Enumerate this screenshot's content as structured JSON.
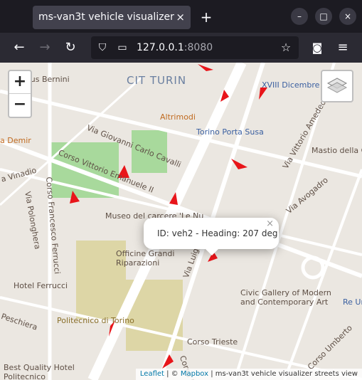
{
  "browser": {
    "tab_title": "ms-van3t vehicle visualizer",
    "tab_close": "×",
    "new_tab": "+",
    "url_host": "127.0.0.1",
    "url_port": ":8080",
    "icons": [
      "back-icon",
      "forward-icon",
      "reload-icon",
      "shield-icon",
      "page-icon",
      "star-icon",
      "pocket-icon",
      "menu-icon"
    ]
  },
  "map": {
    "zoom_in": "+",
    "zoom_out": "−",
    "popup_text": "ID: veh2 - Heading: 207 deg",
    "popup_close": "×",
    "attribution": {
      "leaflet": "Leaflet",
      "sep1": " | © ",
      "mapbox": "Mapbox",
      "tail": " | ms-van3t vehicle visualizer streets view"
    },
    "labels": [
      "mplus Bernini",
      "CIT TURIN",
      "XVIII Dicembre",
      "Altrimodi",
      "Via Giovanni Carlo Cavalli",
      "Torino Porta Susa",
      "Corso Vittorio Emanuele II",
      "a Demir",
      "Via Vittorio Amedeo 2°",
      "Mastio della C",
      "a Vinadio",
      "Corso Francesco Ferrucci",
      "Via Polonghera",
      "Museo del carcere 'Le Nu",
      "Via Avogadro",
      "Officine Grandi Riparazioni",
      "Via Luigi Co",
      "Hotel Ferrucci",
      "Civic Gallery of Modern and Contemporary Art",
      "Re Um",
      "Politecnico di Torino",
      "Peschiera",
      "Corso Trieste",
      "Best Quality Hotel Politecnico",
      "Corso Umberto",
      "Corso Re"
    ],
    "accent_color": "#e8151a"
  }
}
